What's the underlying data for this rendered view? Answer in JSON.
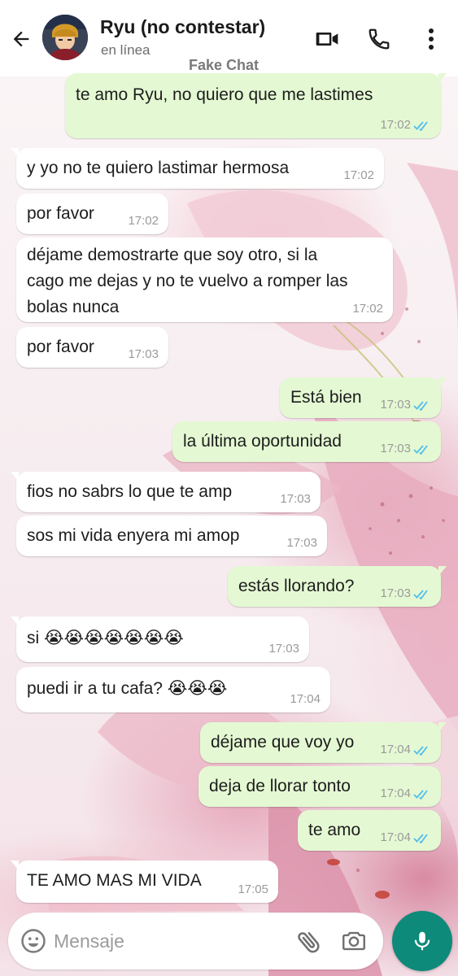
{
  "header": {
    "contact_name": "Ryu (no contestar)",
    "status": "en línea",
    "overlay_label": "Fake Chat",
    "icons": [
      "back-arrow-icon",
      "video-call-icon",
      "phone-icon",
      "more-options-icon"
    ]
  },
  "messages": [
    {
      "direction": "out",
      "text": "te amo Ryu, no quiero que me lastimes",
      "time": "17:02",
      "read": true
    },
    {
      "direction": "in",
      "text": "y yo no te quiero lastimar hermosa",
      "time": "17:02"
    },
    {
      "direction": "in",
      "text": "por favor",
      "time": "17:02"
    },
    {
      "direction": "in",
      "lines": [
        "déjame demostrarte que soy otro, si la",
        "cago me dejas y no te vuelvo a romper las",
        "bolas nunca"
      ],
      "time": "17:02"
    },
    {
      "direction": "in",
      "text": "por favor",
      "time": "17:03"
    },
    {
      "direction": "out",
      "text": "Está bien",
      "time": "17:03",
      "read": true
    },
    {
      "direction": "out",
      "text": "la última oportunidad",
      "time": "17:03",
      "read": true
    },
    {
      "direction": "in",
      "text": "fios no sabrs lo que te amp",
      "time": "17:03"
    },
    {
      "direction": "in",
      "text": "sos mi vida enyera mi amop",
      "time": "17:03"
    },
    {
      "direction": "out",
      "text": "estás llorando?",
      "time": "17:03",
      "read": true
    },
    {
      "direction": "in",
      "text": "si 😭😭😭😭😭😭😭",
      "time": "17:03"
    },
    {
      "direction": "in",
      "text": "puedi ir a tu cafa? 😭😭😭",
      "time": "17:04"
    },
    {
      "direction": "out",
      "text": "déjame que voy yo",
      "time": "17:04",
      "read": true
    },
    {
      "direction": "out",
      "text": "deja de llorar tonto",
      "time": "17:04",
      "read": true
    },
    {
      "direction": "out",
      "text": "te amo",
      "time": "17:04",
      "read": true
    },
    {
      "direction": "in",
      "text": "TE AMO MAS MI VIDA",
      "time": "17:05"
    }
  ],
  "composer": {
    "placeholder": "Mensaje",
    "icons": [
      "emoji-icon",
      "attach-icon",
      "camera-icon",
      "mic-icon"
    ]
  },
  "colors": {
    "outgoing_bubble": "#e4f9d3",
    "incoming_bubble": "#ffffff",
    "read_ticks": "#53bdeb",
    "mic_button": "#0d8a79"
  }
}
